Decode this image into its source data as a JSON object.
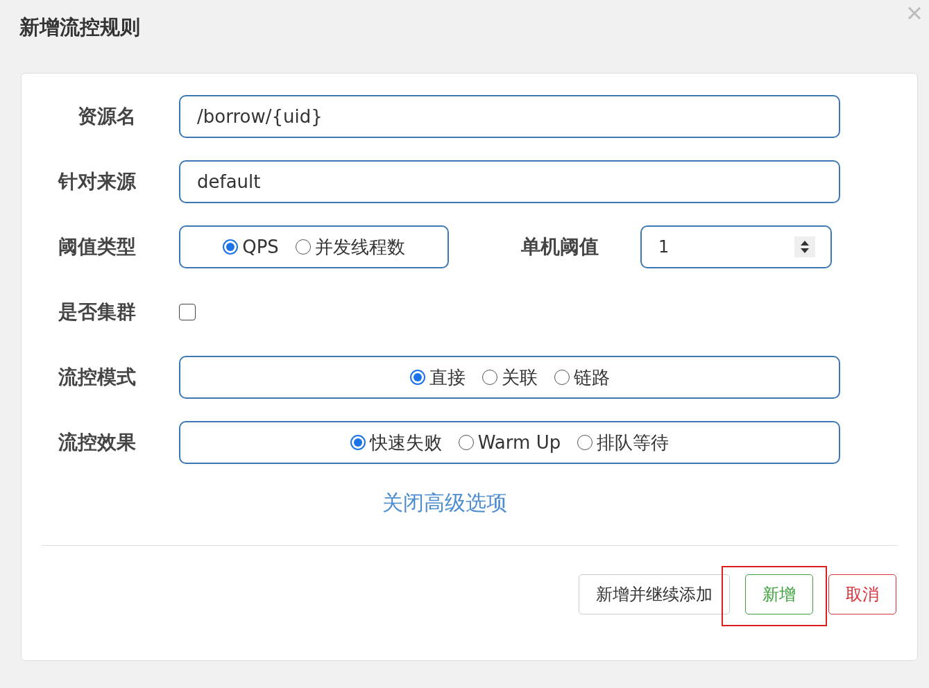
{
  "dialog": {
    "title": "新增流控规则"
  },
  "rows": [
    {
      "kind": "text",
      "label": "资源名",
      "value": "/borrow/{uid}"
    },
    {
      "kind": "text",
      "label": "针对来源",
      "value": "default"
    },
    {
      "kind": "radio_number",
      "label": "阈值类型",
      "options": [
        {
          "label": "QPS",
          "selected": true
        },
        {
          "label": "并发线程数",
          "selected": false
        }
      ],
      "number_label": "单机阈值",
      "number_value": "1"
    },
    {
      "kind": "checkbox",
      "label": "是否集群",
      "checked": false
    },
    {
      "kind": "radio",
      "label": "流控模式",
      "options": [
        {
          "label": "直接",
          "selected": true
        },
        {
          "label": "关联",
          "selected": false
        },
        {
          "label": "链路",
          "selected": false
        }
      ]
    },
    {
      "kind": "radio",
      "label": "流控效果",
      "options": [
        {
          "label": "快速失败",
          "selected": true
        },
        {
          "label": "Warm Up",
          "selected": false
        },
        {
          "label": "排队等待",
          "selected": false
        }
      ]
    }
  ],
  "advanced_link": "关闭高级选项",
  "buttons": [
    {
      "kind": "default",
      "label": "新增并继续添加",
      "highlighted": false
    },
    {
      "kind": "success",
      "label": "新增",
      "highlighted": true
    },
    {
      "kind": "danger",
      "label": "取消",
      "highlighted": false
    }
  ]
}
